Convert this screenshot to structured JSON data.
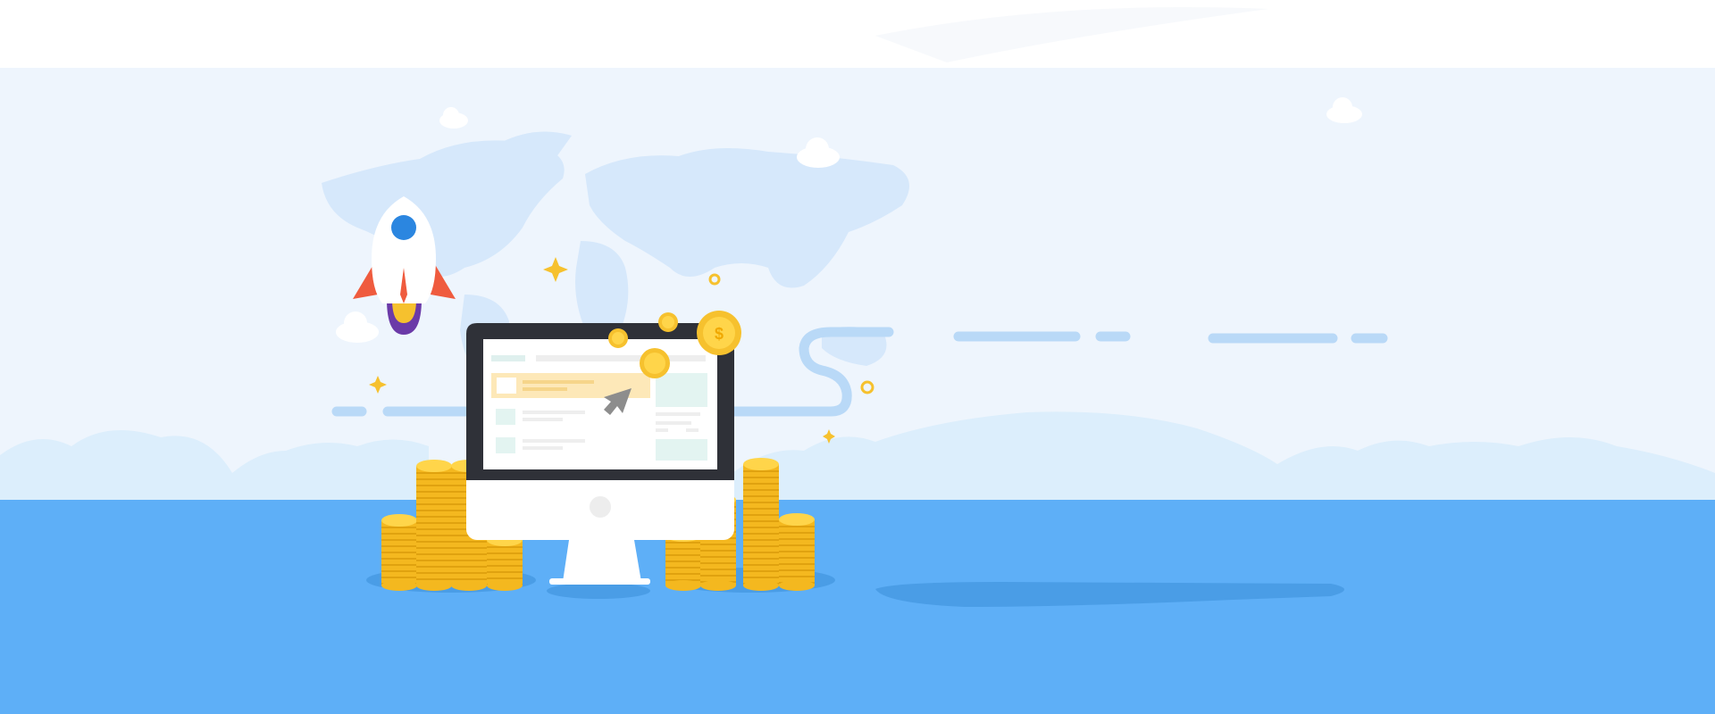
{
  "banner": {
    "colors": {
      "sky": "#eef5fd",
      "floor": "#5eaff7",
      "map": "#d6e8fb",
      "hills": "#dceefc",
      "accent_coin": "#f6c12e",
      "monitor_frame": "#2f3138",
      "rocket_window": "#2b86e0",
      "rocket_fin": "#ef5b3e",
      "dash_lines": "#b9d9f7"
    },
    "icons": [
      "cloud-icon",
      "world-map-icon",
      "rocket-icon",
      "sparkle-star-icon",
      "monitor-icon",
      "cursor-arrow-icon",
      "gold-coin-icon",
      "coin-stack-icon"
    ]
  }
}
